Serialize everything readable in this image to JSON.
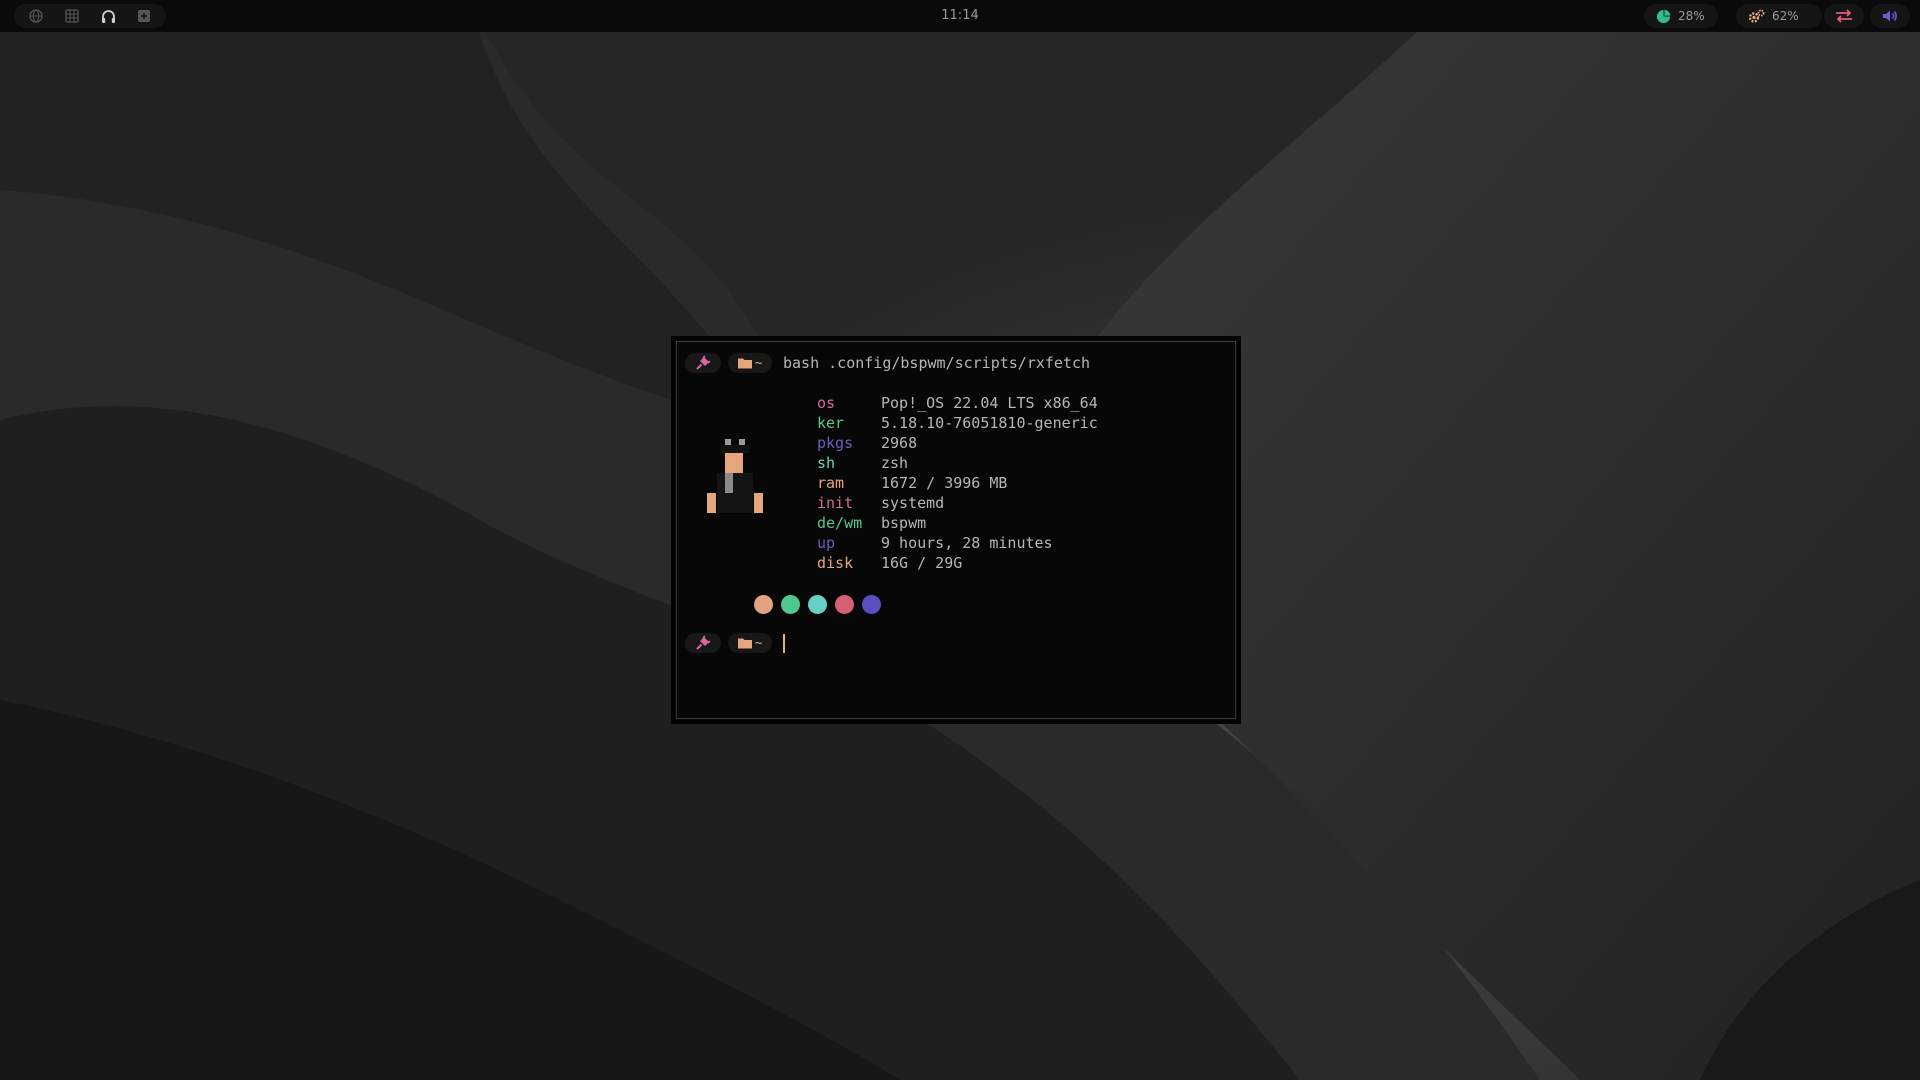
{
  "colors": {
    "pink": "#d7689f",
    "green": "#59c98a",
    "purple": "#6b5ec2",
    "cyan": "#6cd4c6",
    "peach": "#e5a57d",
    "red": "#d9607a",
    "volume": "#6a5fd8"
  },
  "topbar": {
    "workspaces": [
      {
        "icon": "globe-icon"
      },
      {
        "icon": "grid-icon"
      },
      {
        "icon": "headphones-icon"
      },
      {
        "icon": "plus-square-icon"
      }
    ],
    "clock": "11:14",
    "cpu": {
      "icon": "pie-chart-icon",
      "value": "28%"
    },
    "memory": {
      "icon": "gears-icon",
      "value": "62%"
    },
    "network": {
      "icon": "arrows-swap-icon"
    },
    "volume": {
      "icon": "speaker-icon"
    }
  },
  "terminal": {
    "prompt": {
      "icon": "plug-icon",
      "folder_icon": "folder-icon",
      "dir": "~"
    },
    "command": "bash .config/bspwm/scripts/rxfetch",
    "fetch": [
      {
        "key": "os",
        "value": "Pop!_OS 22.04 LTS x86_64",
        "color": "pink"
      },
      {
        "key": "ker",
        "value": "5.18.10-76051810-generic",
        "color": "green"
      },
      {
        "key": "pkgs",
        "value": "2968",
        "color": "purple"
      },
      {
        "key": "sh",
        "value": "zsh",
        "color": "cyan"
      },
      {
        "key": "ram",
        "value": "1672 / 3996 MB",
        "color": "peach"
      },
      {
        "key": "init",
        "value": "systemd",
        "color": "pink"
      },
      {
        "key": "de/wm",
        "value": "bspwm",
        "color": "green"
      },
      {
        "key": "up",
        "value": "9 hours, 28 minutes",
        "color": "purple"
      },
      {
        "key": "disk",
        "value": "16G / 29G",
        "color": "peach"
      }
    ],
    "color_dots": [
      "#e2a37e",
      "#4fc88e",
      "#66d0c4",
      "#d65f74",
      "#5b4ec0"
    ]
  }
}
